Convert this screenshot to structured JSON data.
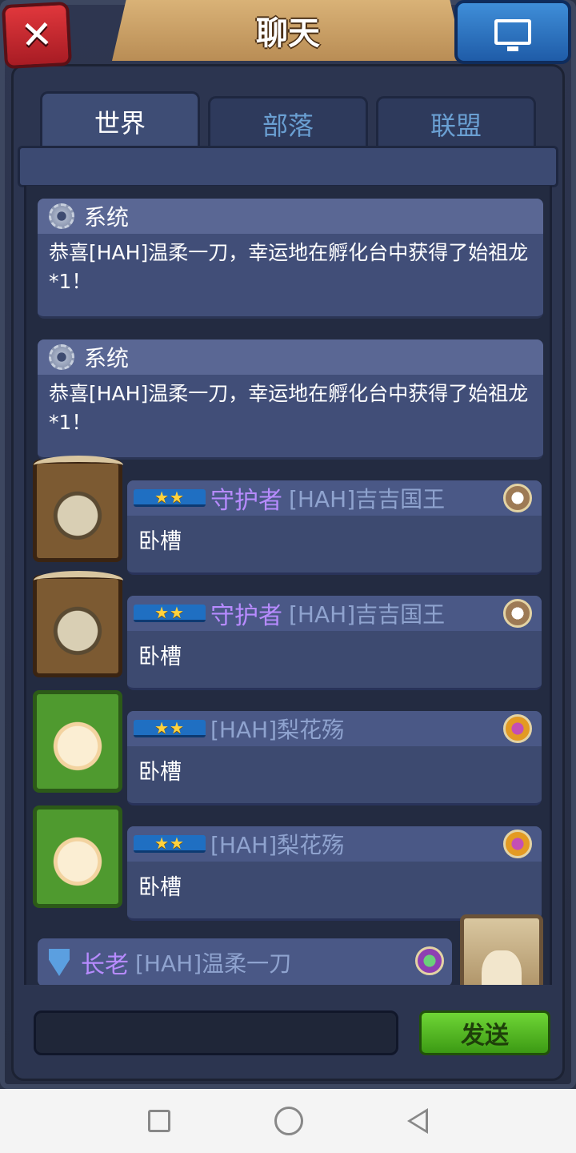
{
  "header": {
    "title": "聊天",
    "close_icon": "close-icon",
    "screen_icon": "monitor-icon"
  },
  "tabs": [
    {
      "label": "世界",
      "active": true
    },
    {
      "label": "部落",
      "active": false
    },
    {
      "label": "联盟",
      "active": false
    }
  ],
  "system_messages": [
    {
      "sender": "系统",
      "text": "恭喜[HAH]温柔一刀，幸运地在孵化台中获得了始祖龙*1！"
    },
    {
      "sender": "系统",
      "text": "恭喜[HAH]温柔一刀，幸运地在孵化台中获得了始祖龙*1！"
    }
  ],
  "user_messages": [
    {
      "rank": "★★",
      "role": "守护者",
      "name": "[HAH]吉吉国王",
      "text": "卧槽",
      "avatar": "bull-avatar"
    },
    {
      "rank": "★★",
      "role": "守护者",
      "name": "[HAH]吉吉国王",
      "text": "卧槽",
      "avatar": "bull-avatar"
    },
    {
      "rank": "★★",
      "role": "",
      "name": "[HAH]梨花殇",
      "text": "卧槽",
      "avatar": "flower-avatar"
    },
    {
      "rank": "★★",
      "role": "",
      "name": "[HAH]梨花殇",
      "text": "卧槽",
      "avatar": "flower-avatar"
    }
  ],
  "elder_message": {
    "role": "长老",
    "name": "[HAH]温柔一刀"
  },
  "input": {
    "value": "",
    "placeholder": ""
  },
  "send_button": {
    "label": "发送"
  },
  "colors": {
    "role_purple": "#b78bff",
    "name_blue": "#8fa3cf",
    "send_green": "#5cc12a"
  }
}
